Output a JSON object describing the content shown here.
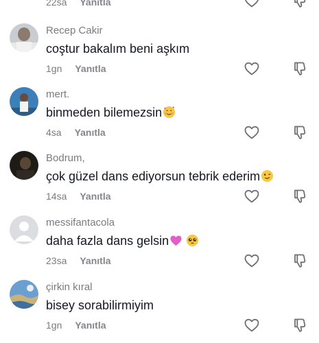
{
  "colors": {
    "text": "#161823",
    "secondary_text": "#7a7b80",
    "icon_stroke": "#6f7075",
    "background": "#ffffff"
  },
  "icons": {
    "like": "heart-outline-icon",
    "dislike": "thumbs-down-outline-icon"
  },
  "top_partial": {
    "time": "22sa",
    "reply_label": "Yanıtla"
  },
  "comments": [
    {
      "username": "Recep Cakir",
      "text": "coştur bakalım beni aşkım",
      "emojis": [],
      "time": "1gn",
      "reply_label": "Yanıtla",
      "avatar": "photo-man-gray"
    },
    {
      "username": "mert.",
      "text": "binmeden bilemezsin",
      "emojis": [
        "smiling-face-with-hearts"
      ],
      "time": "4sa",
      "reply_label": "Yanıtla",
      "avatar": "photo-person-blue"
    },
    {
      "username": "Bodrum,",
      "text": "çok güzel dans ediyorsun tebrik ederim",
      "emojis": [
        "winking-face"
      ],
      "time": "14sa",
      "reply_label": "Yanıtla",
      "avatar": "photo-dark"
    },
    {
      "username": "messifantacola",
      "text": "daha fazla dans gelsin",
      "emojis": [
        "pink-heart",
        "pleading-face"
      ],
      "time": "23sa",
      "reply_label": "Yanıtla",
      "avatar": "default-avatar"
    },
    {
      "username": "çirkin kıral",
      "text": "bisey sorabilirmiyim",
      "emojis": [],
      "time": "1gn",
      "reply_label": "Yanıtla",
      "avatar": "photo-landscape-blue"
    }
  ]
}
